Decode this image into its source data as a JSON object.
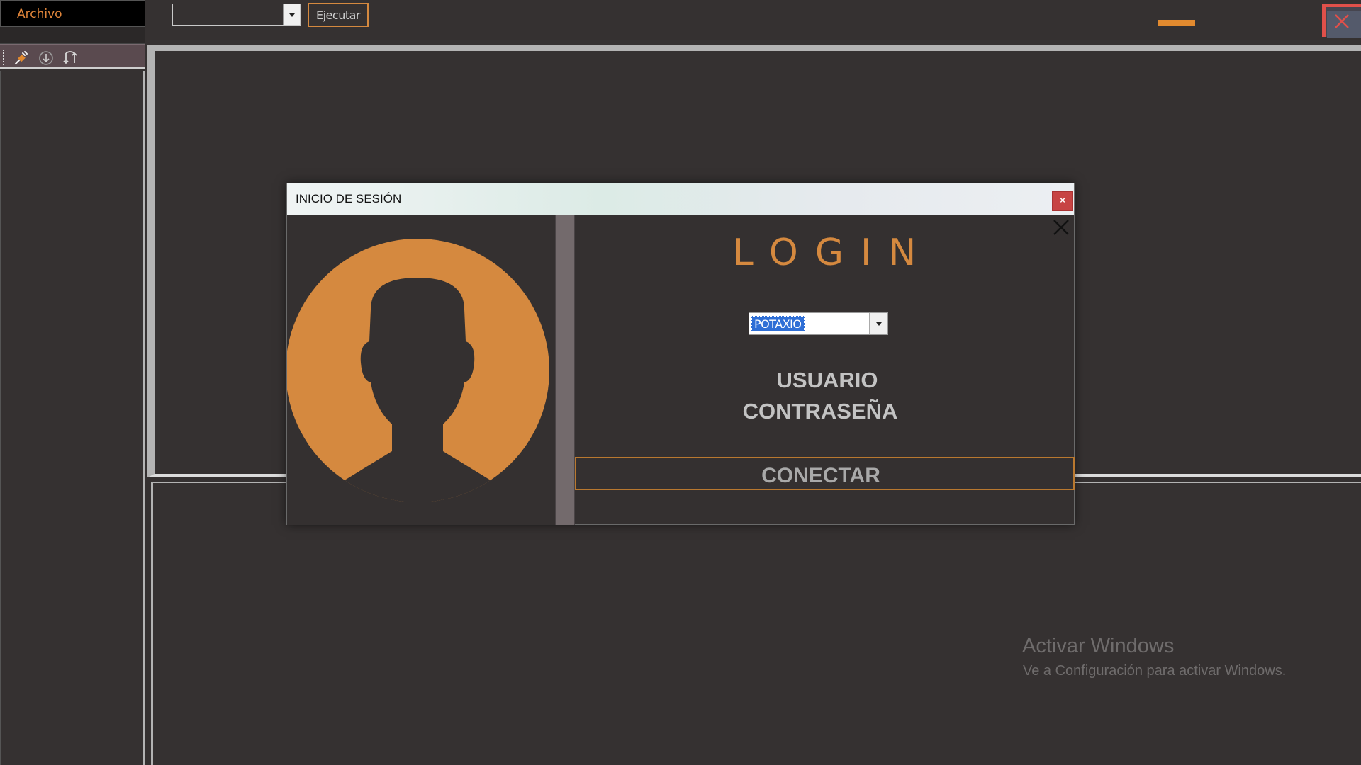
{
  "menubar": {
    "archivo": "Archivo"
  },
  "toolbar": {
    "combo_value": "",
    "execute_label": "Ejecutar",
    "icons": [
      "plug-icon",
      "download-icon",
      "refresh-icon"
    ]
  },
  "dialog": {
    "title": "INICIO DE SESIÓN",
    "close_glyph": "×",
    "heading": "LOGIN",
    "server_value": "POTAXIO",
    "user_label": "USUARIO",
    "password_label": "CONTRASEÑA",
    "connect_label": "CONECTAR"
  },
  "watermark": {
    "title": "Activar Windows",
    "subtitle": "Ve a Configuración para activar Windows."
  },
  "colors": {
    "accent": "#d5893f",
    "background": "#353131",
    "close_red": "#c74444"
  }
}
